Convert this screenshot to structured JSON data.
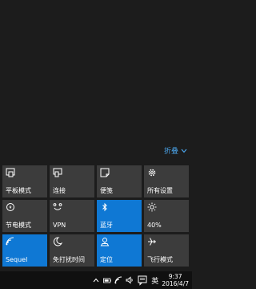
{
  "action_center": {
    "collapse_label": "折叠",
    "tiles": [
      {
        "label": "平板模式",
        "icon": "tablet-mode-icon",
        "active": false
      },
      {
        "label": "连接",
        "icon": "connect-icon",
        "active": false
      },
      {
        "label": "便笺",
        "icon": "note-icon",
        "active": false
      },
      {
        "label": "所有设置",
        "icon": "gear-icon",
        "active": false
      },
      {
        "label": "节电模式",
        "icon": "battery-saver-icon",
        "active": false
      },
      {
        "label": "VPN",
        "icon": "vpn-icon",
        "active": false
      },
      {
        "label": "蓝牙",
        "icon": "bluetooth-icon",
        "active": true
      },
      {
        "label": "40%",
        "icon": "brightness-icon",
        "active": false
      },
      {
        "label": "Sequel",
        "icon": "wifi-icon",
        "active": true
      },
      {
        "label": "免打扰时间",
        "icon": "moon-icon",
        "active": false
      },
      {
        "label": "定位",
        "icon": "location-icon",
        "active": true
      },
      {
        "label": "飞行模式",
        "icon": "airplane-icon",
        "active": false
      }
    ]
  },
  "taskbar": {
    "ime": "英",
    "time": "9:37",
    "date": "2016/4/7"
  },
  "colors": {
    "accent": "#0f78d4",
    "tile": "#3c3c3c",
    "background": "#1c1c1c"
  }
}
